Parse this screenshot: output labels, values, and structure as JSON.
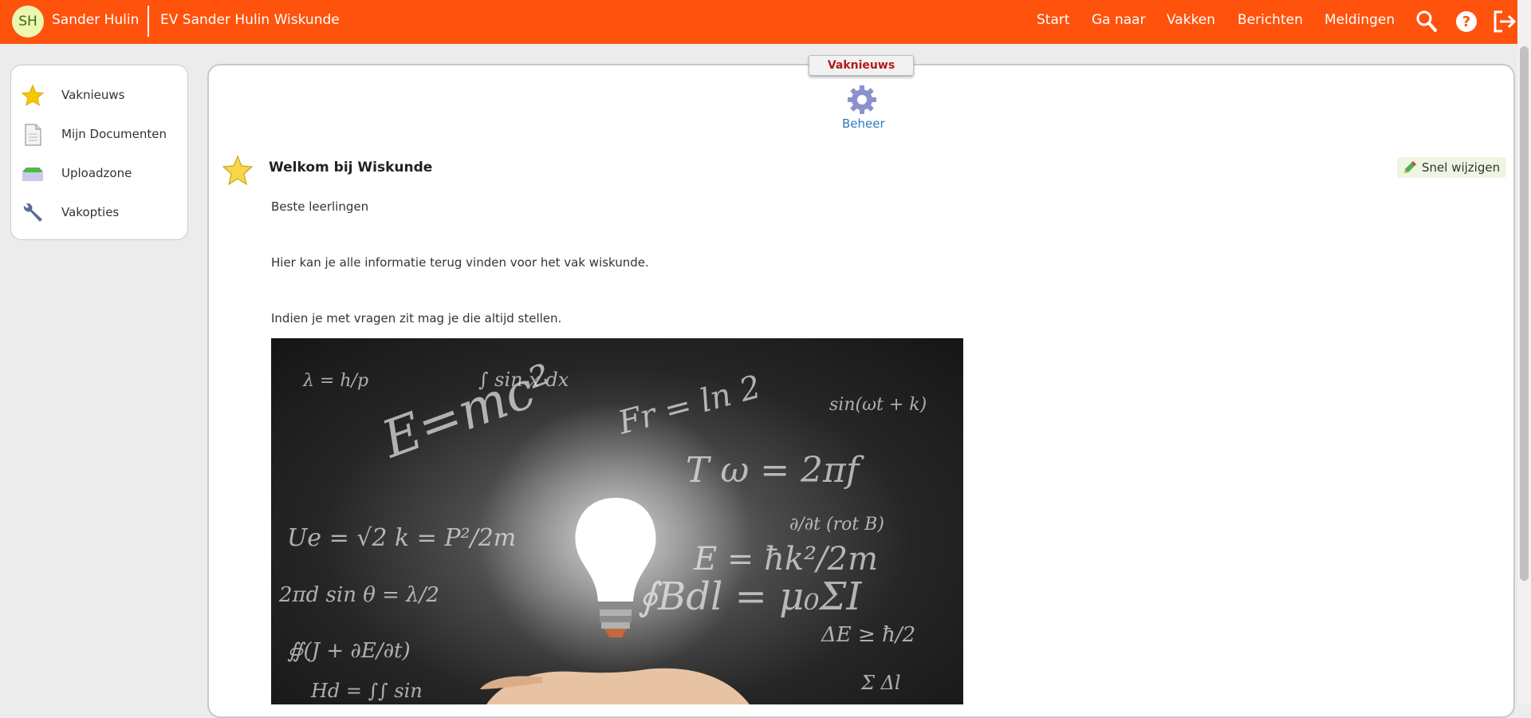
{
  "topbar": {
    "avatar_initials": "SH",
    "user_name": "Sander Hulin",
    "course_title": "EV Sander Hulin Wiskunde",
    "nav": [
      "Start",
      "Ga naar",
      "Vakken",
      "Berichten",
      "Meldingen"
    ],
    "icons": [
      "search-icon",
      "help-icon",
      "logout-icon"
    ],
    "colors": {
      "bar": "#ff520d",
      "avatar_bg": "#eef7b0"
    }
  },
  "sidebar": {
    "items": [
      {
        "label": "Vaknieuws",
        "icon": "star-icon"
      },
      {
        "label": "Mijn Documenten",
        "icon": "document-icon"
      },
      {
        "label": "Uploadzone",
        "icon": "upload-tray-icon"
      },
      {
        "label": "Vakopties",
        "icon": "wrench-icon"
      }
    ]
  },
  "main": {
    "tab_label": "Vaknieuws",
    "beheer_label": "Beheer",
    "news": {
      "title": "Welkom bij Wiskunde",
      "quick_edit_label": "Snel wijzigen",
      "paragraphs": [
        "Beste leerlingen",
        "Hier kan je alle informatie terug vinden voor het vak wiskunde.",
        "Indien je met vragen zit mag je die altijd stellen."
      ],
      "image_description": "Lightbulb above hand with math formulas"
    }
  }
}
